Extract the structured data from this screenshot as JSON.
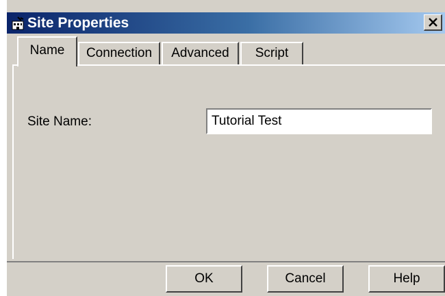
{
  "window": {
    "title": "Site Properties",
    "close_label": "X"
  },
  "tabs": [
    {
      "label": "Name",
      "selected": true
    },
    {
      "label": "Connection",
      "selected": false
    },
    {
      "label": "Advanced",
      "selected": false
    },
    {
      "label": "Script",
      "selected": false
    }
  ],
  "form": {
    "site_name_label": "Site Name:",
    "site_name_value": "Tutorial Test"
  },
  "buttons": {
    "ok": "OK",
    "cancel": "Cancel",
    "help": "Help"
  },
  "icons": {
    "app": "site-icon",
    "close": "close-icon"
  },
  "colors": {
    "titlebar_start": "#0a246a",
    "titlebar_end": "#a6caf0",
    "dialog_face": "#d4d0c8"
  }
}
